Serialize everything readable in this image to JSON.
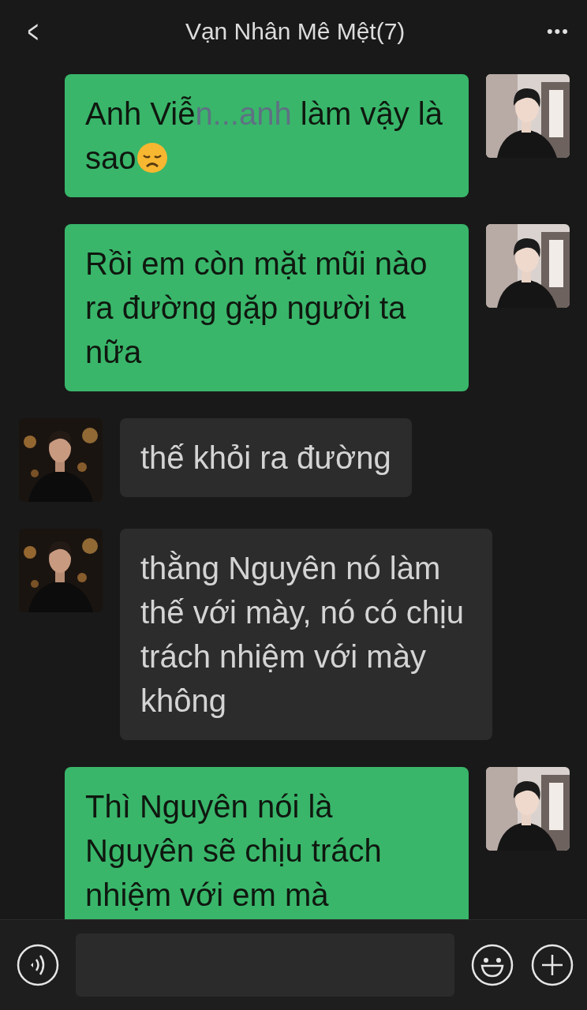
{
  "header": {
    "back": "<",
    "title": "Vạn Nhân Mê Mệt(7)",
    "more": "•••"
  },
  "messages": [
    {
      "kind": "outgoing",
      "parts": [
        {
          "text": "Anh Viễ",
          "kind": "plain"
        },
        {
          "text": "n...anh",
          "kind": "tinted"
        },
        {
          "text": " làm vậy là sao",
          "kind": "plain"
        }
      ],
      "emoji": true
    },
    {
      "kind": "outgoing",
      "parts": [
        {
          "text": "Rồi em còn mặt mũi nào ra đường gặp người ta nữa",
          "kind": "plain"
        }
      ],
      "emoji": false
    },
    {
      "kind": "incoming",
      "parts": [
        {
          "text": "thế khỏi ra đường",
          "kind": "plain"
        }
      ],
      "emoji": false
    },
    {
      "kind": "incoming",
      "parts": [
        {
          "text": "thằng Nguyên nó làm thế với mày, nó có chịu trách nhiệm với mày không",
          "kind": "plain"
        }
      ],
      "emoji": false
    },
    {
      "kind": "outgoing",
      "parts": [
        {
          "text": "Thì Nguyên nói là Nguyên sẽ chịu trách nhiệm với em mà",
          "kind": "plain"
        }
      ],
      "emoji": false
    }
  ]
}
